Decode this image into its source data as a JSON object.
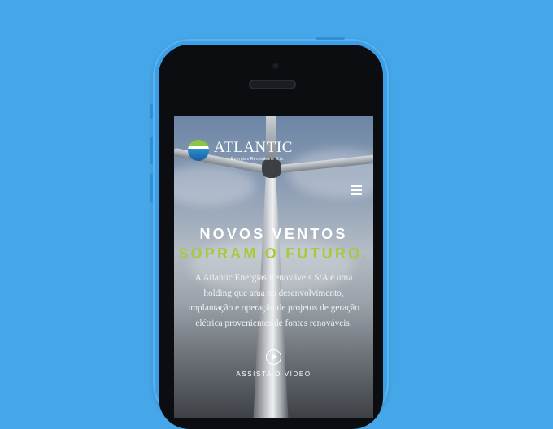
{
  "site": {
    "brand_name": "ATLANTIC",
    "brand_tagline": "Energias Renováveis S.A."
  },
  "hero": {
    "headline_line1": "NOVOS VENTOS",
    "headline_line2": "SOPRAM O FUTURO.",
    "description": "A Atlantic Energias Renováveis S/A é uma holding que atua no desenvolvimento, implantação e operação de projetos de geração elétrica provenientes de fontes renováveis.",
    "video_label": "ASSISTA O VÍDEO"
  },
  "icons": {
    "menu": "hamburger-menu-icon",
    "play": "play-icon",
    "logo": "atlantic-logo-mark"
  },
  "colors": {
    "background": "#45a6e8",
    "phone_body": "#3b9ee6",
    "accent_green": "#a8c93a",
    "text_white": "#ffffff"
  }
}
